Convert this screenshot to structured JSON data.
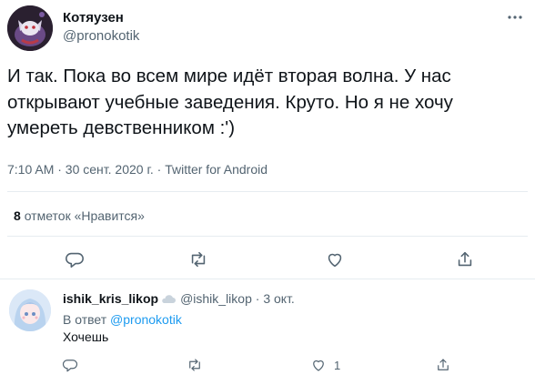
{
  "tweet": {
    "display_name": "Котяузен",
    "handle": "@pronokotik",
    "text": "И так. Пока во всем мире идёт вторая волна. У нас открывают учебные заведения. Круто. Но я не хочу умереть девственником :')",
    "meta": "7:10 AM · 30 сент. 2020 г. · Twitter for Android",
    "likes_count": "8",
    "likes_label": "отметок «Нравится»",
    "actions": [
      "reply-icon",
      "retweet-icon",
      "like-icon",
      "share-icon"
    ]
  },
  "reply": {
    "display_name": "ishik_kris_likop",
    "handle": "@ishik_likop",
    "separator": "·",
    "date": "3 окт.",
    "reply_to_prefix": "В ответ",
    "reply_to_handle": "@pronokotik",
    "text": "Хочешь",
    "like_count": "1",
    "actions": [
      "reply-icon",
      "retweet-icon",
      "like-icon",
      "share-icon"
    ]
  },
  "colors": {
    "accent": "#1d9bf0",
    "text": "#0f1419",
    "secondary": "#536471",
    "divider": "#e6ecf0"
  }
}
